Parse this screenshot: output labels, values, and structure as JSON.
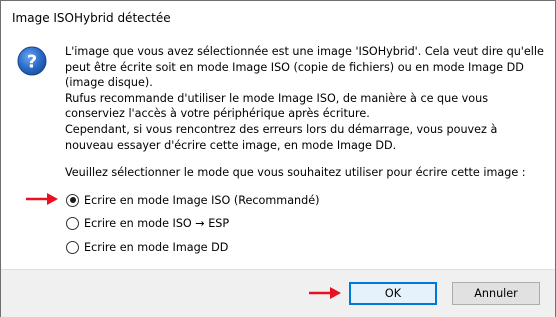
{
  "window": {
    "title": "Image ISOHybrid détectée"
  },
  "icon": "question-icon",
  "message": {
    "paragraph1": "L'image que vous avez sélectionnée est une image 'ISOHybrid'. Cela veut dire qu'elle peut être écrite soit en mode Image ISO (copie de fichiers) ou en mode Image DD (image disque).",
    "paragraph2": "Rufus recommande d'utiliser le mode Image ISO, de manière à ce que vous conserviez l'accès à votre périphérique après écriture.",
    "paragraph3": "Cependant, si vous rencontrez des erreurs lors du démarrage, vous pouvez à nouveau essayer d'écrire cette image, en mode Image DD."
  },
  "prompt": "Veuillez sélectionner le mode que vous souhaitez utiliser pour écrire cette image :",
  "options": [
    {
      "label": "Ecrire en mode Image ISO (Recommandé)",
      "selected": true
    },
    {
      "label": "Ecrire en mode ISO → ESP",
      "selected": false
    },
    {
      "label": "Ecrire en mode Image DD",
      "selected": false
    }
  ],
  "buttons": {
    "ok_label": "OK",
    "cancel_label": "Annuler"
  },
  "colors": {
    "arrow": "#e81123",
    "accent": "#0078d7",
    "icon_blue": "#1f5fb8"
  }
}
